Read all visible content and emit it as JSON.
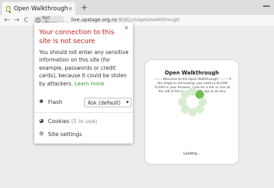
{
  "tab": {
    "title": "Open Walkthrough",
    "close": "×"
  },
  "new_tab": "+",
  "toolbar": {
    "back": "←",
    "forward": "→",
    "reload": "C"
  },
  "address": {
    "security_label": "Not secure",
    "host": "live.upstage.org.nz",
    "path": ":8081/stages/walkthrough"
  },
  "popup": {
    "close": "×",
    "title": "Your connection to this site is not secure",
    "body": "You should not enter any sensitive information on this site (for example, passwords or credit cards), because it could be stolen by attackers.",
    "learn_more": "Learn more",
    "flash_label": "Flash",
    "flash_value": "Ask (default)",
    "cookies_label": "Cookies",
    "cookies_count": "(1 in use)",
    "site_settings_label": "Site settings"
  },
  "card": {
    "title": "Open Walkthrough",
    "message": "------- Welcome to the Open Walkthrough! ------- If the stage is not loading, you need to ALLOW FLASH in your browser. Look for a link or icon at the left of the browser's URL bar to do this.",
    "loading": "Loading..."
  },
  "colors": {
    "warning": "#c5221f",
    "link": "#3b9b3b",
    "spinner_active": "#6cbf4e",
    "spinner_idle": "#d7ecd1"
  }
}
